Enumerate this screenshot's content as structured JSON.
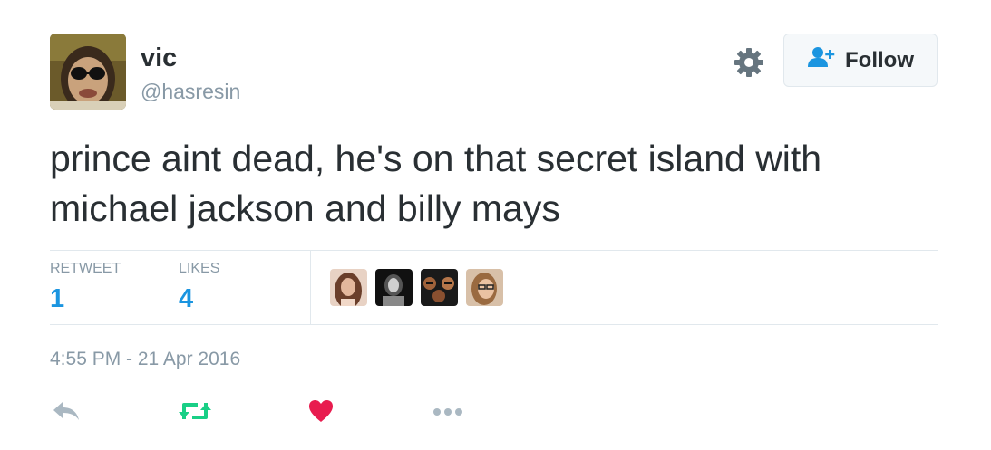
{
  "user": {
    "name": "vic",
    "handle": "@hasresin"
  },
  "follow_button": {
    "label": "Follow",
    "icon": "add-user-icon"
  },
  "tweet": {
    "text": "prince aint dead, he's on that secret island with michael jackson and billy mays",
    "timestamp": "4:55 PM - 21 Apr 2016"
  },
  "stats": {
    "retweet_label": "RETWEET",
    "retweet_count": "1",
    "likes_label": "LIKES",
    "likes_count": "4"
  },
  "likers": [
    "liker-avatar",
    "liker-avatar",
    "liker-avatar",
    "liker-avatar"
  ],
  "actions": [
    "reply-icon",
    "retweet-icon",
    "heart-icon",
    "more-icon"
  ],
  "colors": {
    "accent": "#1b95e0",
    "retweet": "#19cf86",
    "like": "#e81c4f",
    "muted": "#8899a6",
    "text": "#292f33"
  }
}
